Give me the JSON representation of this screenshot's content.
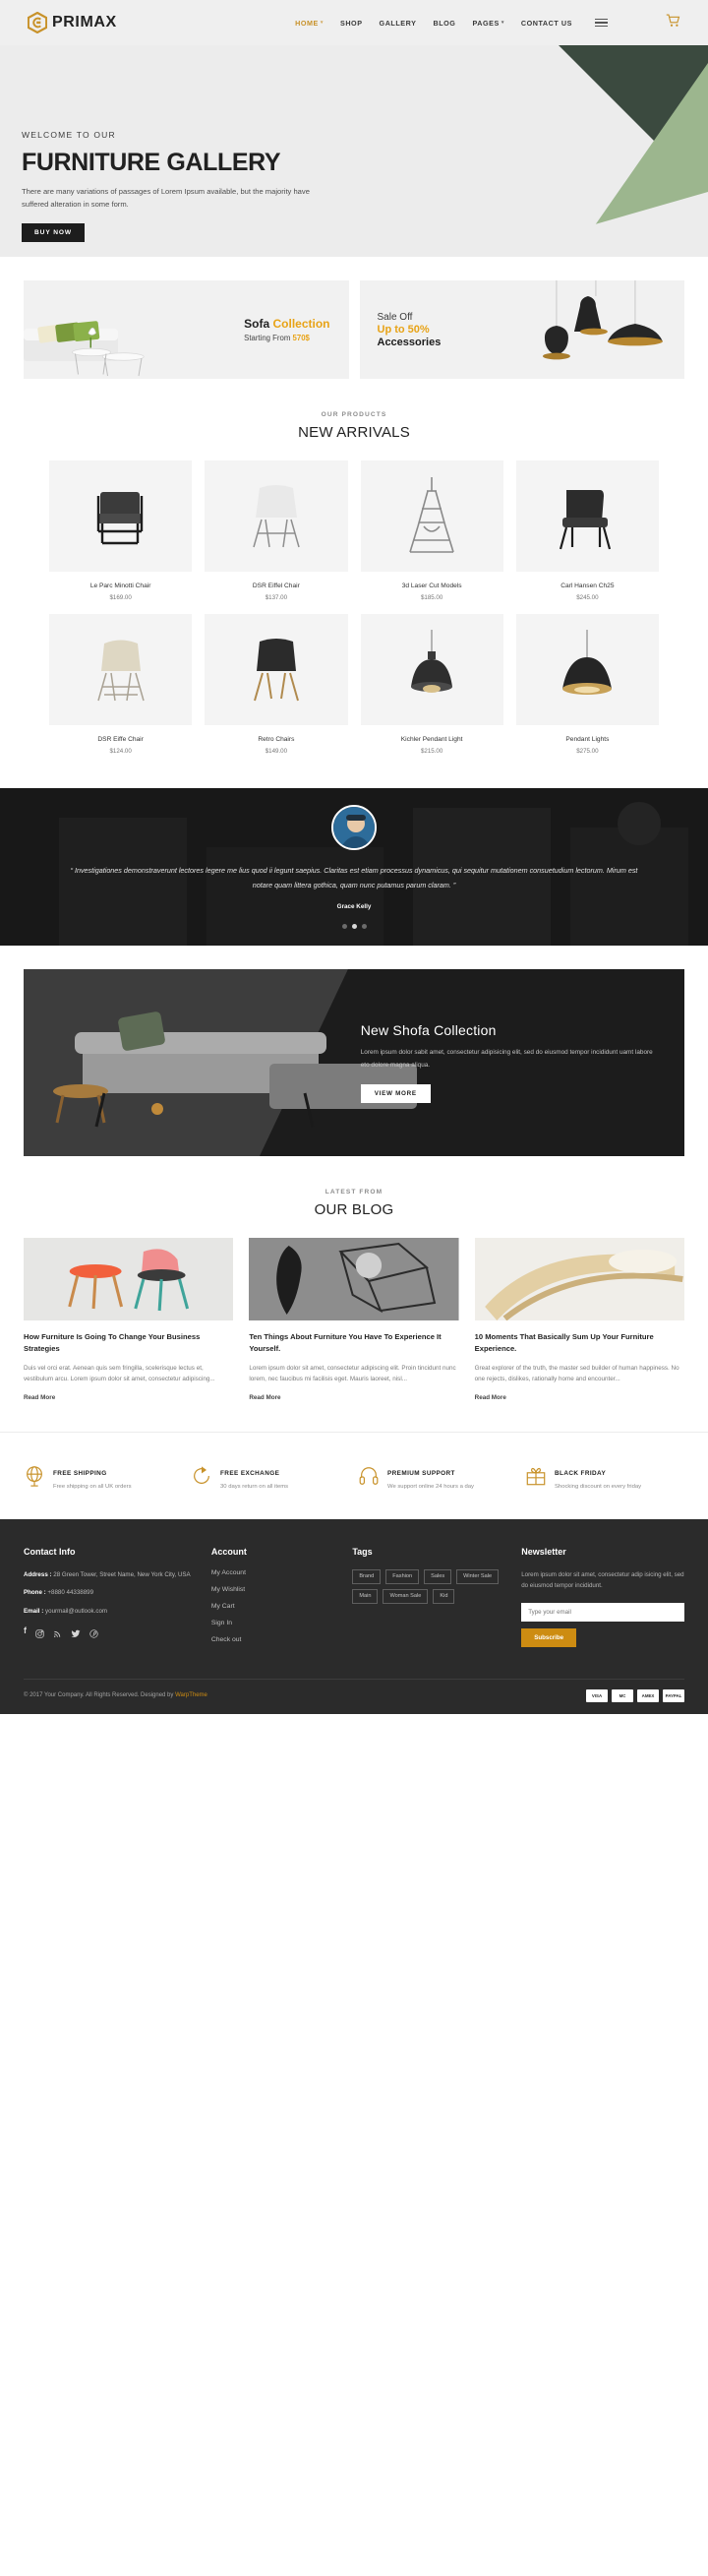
{
  "header": {
    "brand": "PRIMAX",
    "nav": [
      {
        "label": "HOME",
        "active": true,
        "caret": true
      },
      {
        "label": "SHOP",
        "active": false,
        "caret": false
      },
      {
        "label": "GALLERY",
        "active": false,
        "caret": false
      },
      {
        "label": "BLOG",
        "active": false,
        "caret": false
      },
      {
        "label": "PAGES",
        "active": false,
        "caret": true
      },
      {
        "label": "CONTACT US",
        "active": false,
        "caret": false
      }
    ],
    "menu_icon": "hamburger-icon",
    "cart_icon": "shopping-cart-icon"
  },
  "hero": {
    "welcome": "WELCOME TO OUR",
    "title": "FURNITURE GALLERY",
    "subtitle": "There are many variations of passages of Lorem Ipsum available, but the majority have suffered alteration in some form.",
    "cta": "BUY NOW"
  },
  "promos": [
    {
      "title_dark": "Sofa",
      "title_accent": "Collection",
      "sub_text": "Starting From",
      "sub_accent": "570$"
    },
    {
      "line1": "Sale Off",
      "line2": "Up to 50%",
      "line3": "Accessories"
    }
  ],
  "products_section": {
    "supertitle": "OUR PRODUCTS",
    "title": "NEW ARRIVALS",
    "items": [
      {
        "name": "Le Parc Minotti Chair",
        "price": "$169.00",
        "art": "armchair-black"
      },
      {
        "name": "DSR Eiffel Chair",
        "price": "$137.00",
        "art": "chair-white"
      },
      {
        "name": "3d Laser Cut Models",
        "price": "$185.00",
        "art": "eiffel-tower"
      },
      {
        "name": "Carl Hansen Ch25",
        "price": "$245.00",
        "art": "lounge-chair-black"
      },
      {
        "name": "DSR Eiffe Chair",
        "price": "$124.00",
        "art": "chair-beige"
      },
      {
        "name": "Retro Chairs",
        "price": "$149.00",
        "art": "chair-dark-wood"
      },
      {
        "name": "Kichler Pendant Light",
        "price": "$215.00",
        "art": "pendant-industrial"
      },
      {
        "name": "Pendant Lights",
        "price": "$275.00",
        "art": "pendant-dome"
      }
    ]
  },
  "testimonial": {
    "quote": "“ Investigationes demonstraverunt lectores legere me lius quod ii legunt saepius. Claritas est etiam processus dynamicus, qui sequitur mutationem consuetudium lectorum. Mirum est notare quam littera gothica, quam nunc putamus parum claram. ”",
    "author": "Grace Kelly",
    "dots": 3,
    "active_dot": 1
  },
  "shofa": {
    "title": "New Shofa Collection",
    "text": "Lorem ipsum dolor sabit amet, consectetur adipisicing elit, sed do eiusmod tempor incididunt uamt labore eto dolore magna aliqua.",
    "cta": "VIEW MORE"
  },
  "blog_section": {
    "supertitle": "LATEST FROM",
    "title": "OUR BLOG",
    "read_more": "Read More",
    "posts": [
      {
        "title": "How Furniture Is Going To Change Your Business Strategies",
        "excerpt": "Duis vel orci erat. Aenean quis sem fringilla, scelerisque lectus et, vestibulum arcu. Lorem ipsum dolor sit amet, consectetur adipiscing...",
        "art": "two-chairs-pink"
      },
      {
        "title": "Ten Things About Furniture You Have To Experience It Yourself.",
        "excerpt": "Lorem ipsum dolor sit amet, consectetur adipiscing elit. Proin tincidunt nunc lorem, nec faucibus mi facilisis eget. Mauris laoreet, nisl...",
        "art": "coat-rack-grid"
      },
      {
        "title": "10 Moments That Basically Sum Up Your Furniture Experience.",
        "excerpt": "Great explorer of the truth, the master sed builder of human happiness. No one rejects, dislikes, rationally home and encounter...",
        "art": "wood-curve"
      }
    ]
  },
  "features": [
    {
      "icon": "globe-icon",
      "title": "FREE SHIPPING",
      "sub": "Free shipping on all UK orders"
    },
    {
      "icon": "refresh-arrow-icon",
      "title": "FREE EXCHANGE",
      "sub": "30 days return on all items"
    },
    {
      "icon": "headset-icon",
      "title": "PREMIUM SUPPORT",
      "sub": "We support online 24 hours a day"
    },
    {
      "icon": "gift-icon",
      "title": "BLACK FRIDAY",
      "sub": "Shocking discount on every friday"
    }
  ],
  "footer": {
    "contact": {
      "heading": "Contact Info",
      "address_label": "Address :",
      "address_value": "28 Green Tower, Street Name, New York City, USA",
      "phone_label": "Phone :",
      "phone_value": "+8880 44338899",
      "email_label": "Email :",
      "email_value": "yourmail@outlook.com",
      "socials": [
        "facebook-icon",
        "instagram-icon",
        "rss-icon",
        "twitter-icon",
        "pinterest-icon"
      ]
    },
    "account": {
      "heading": "Account",
      "links": [
        "My Account",
        "My Wishlist",
        "My Cart",
        "Sign In",
        "Check out"
      ]
    },
    "tags": {
      "heading": "Tags",
      "items": [
        "Brand",
        "Fashion",
        "Sales",
        "Winter Sale",
        "Main",
        "Woman Sale",
        "Kid"
      ]
    },
    "newsletter": {
      "heading": "Newsletter",
      "text": "Lorem ipsum dolor sit amet, consectetur adip isicing elit, sed do eiusmod tempor incididunt.",
      "placeholder": "Type your email",
      "button": "Subscribe"
    },
    "copyright_pre": "© 2017 Your Company. All Rights Reserved. Designed by",
    "copyright_link": "WarpTheme",
    "payments": [
      "VISA",
      "MC",
      "AMEX",
      "PAYPAL"
    ]
  },
  "colors": {
    "accent": "#c8922a",
    "orange": "#e8a317",
    "dark": "#1d1d1d",
    "footer_bg": "#2b2b2b",
    "subscribe": "#cd8c12"
  }
}
